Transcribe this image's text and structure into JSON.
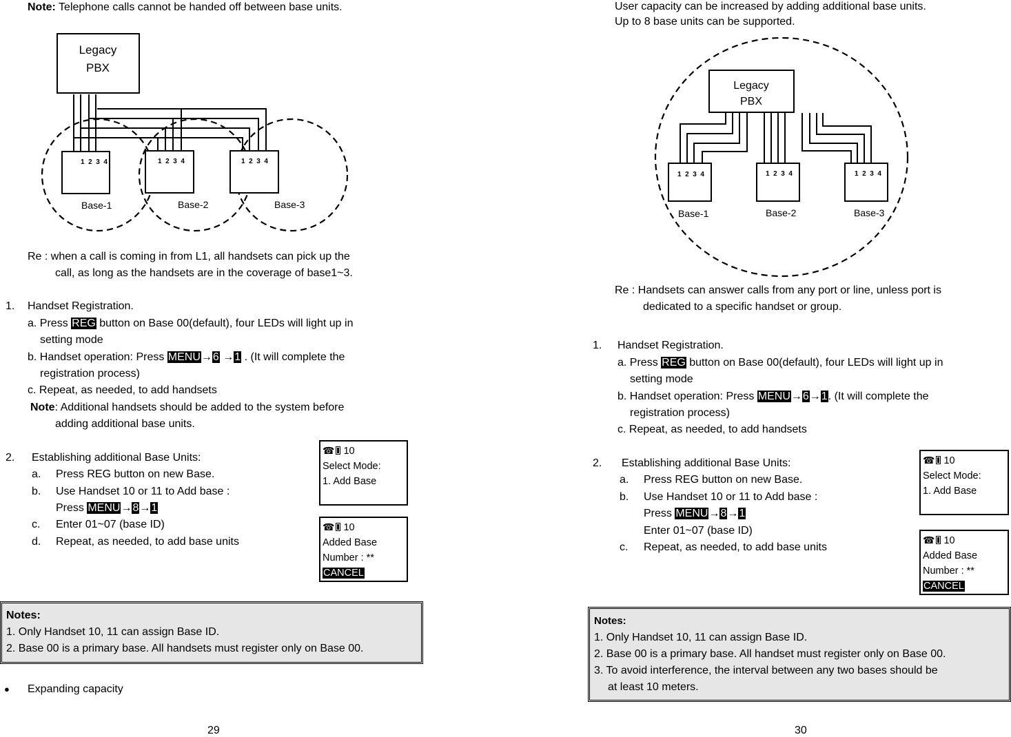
{
  "page_left": {
    "intro_note": {
      "label": "Note:",
      "text": " Telephone calls cannot be handed off between base units."
    },
    "diagram": {
      "pbx_line1": "Legacy",
      "pbx_line2": "PBX",
      "ports": "1  2  3  4",
      "bases": [
        "Base-1",
        "Base-2",
        "Base-3"
      ]
    },
    "re_line1": "Re : when  a call is coming in from L1, all handsets can pick up the",
    "re_line2": "call, as long as the handsets are in the coverage of base1~3.",
    "section1": {
      "num": "1.",
      "title": "Handset Registration.",
      "a_pre": "a. Press ",
      "a_key": "REG",
      "a_post": " button on Base 00(default), four LEDs will light up in",
      "a_cont": "setting mode",
      "b_pre": "b. Handset operation: Press ",
      "b_key1": "MENU",
      "arrow": "→",
      "b_key2": "6",
      "b_key3": "1",
      "b_post": " . (It will complete the",
      "b_cont": "registration process)",
      "c": "c. Repeat, as needed, to add handsets",
      "note_label": "Note",
      "note_text": ": Additional handsets should be added to the system before",
      "note_cont": "adding additional base units."
    },
    "section2": {
      "num": "2.",
      "title": "Establishing additional Base Units:",
      "items": [
        {
          "letter": "a.",
          "text": "Press REG button on new Base."
        },
        {
          "letter": "b.",
          "text": "Use Handset 10 or 11 to Add base :"
        },
        {
          "letter": "c.",
          "text": "Enter 01~07 (base ID)"
        },
        {
          "letter": "d.",
          "text": "Repeat, as needed, to add base units"
        }
      ],
      "press_label": "Press ",
      "key1": "MENU",
      "key2": "8",
      "key3": "1"
    },
    "lcd1": {
      "phone_icon": "☎",
      "handset_num": "10",
      "line2": "Select Mode:",
      "line3": "1. Add Base"
    },
    "lcd2": {
      "phone_icon": "☎",
      "handset_num": "10",
      "line2": "Added Base",
      "line3": "Number : **",
      "line4": "CANCEL"
    },
    "notes": {
      "title": "Notes:",
      "items": [
        "1. Only Handset 10, 11 can assign Base ID.",
        "2. Base 00 is a primary base. All handsets must register only on Base 00."
      ]
    },
    "bullet": {
      "symbol": "●",
      "text": "Expanding capacity"
    },
    "page_number": "29"
  },
  "page_right": {
    "intro_line1": "User capacity can be increased by adding additional base units.",
    "intro_line2": "Up to 8 base units can be supported.",
    "diagram": {
      "pbx_line1": "Legacy",
      "pbx_line2": "PBX",
      "ports": "1  2  3  4",
      "bases": [
        "Base-1",
        "Base-2",
        "Base-3"
      ]
    },
    "re_line1": "Re : Handsets can answer calls from any port or line, unless port is",
    "re_line2": "dedicated to a specific handset or group.",
    "section1": {
      "num": "1.",
      "title": "Handset Registration.",
      "a_pre": "a. Press ",
      "a_key": "REG",
      "a_post": " button on Base 00(default), four LEDs will light up in",
      "a_cont": "setting mode",
      "b_pre": "b. Handset operation: Press ",
      "b_key1": "MENU",
      "arrow": "→",
      "b_key2": "6",
      "b_key3": "1",
      "b_post": ". (It will complete the",
      "b_cont": "registration process)",
      "c": "c. Repeat, as needed, to add handsets"
    },
    "section2": {
      "num": "2.",
      "title": "Establishing additional Base Units:",
      "items": [
        {
          "letter": "a.",
          "text": "Press REG button on new Base."
        },
        {
          "letter": "b.",
          "text": "Use Handset 10 or 11 to Add base :"
        },
        {
          "letter": "c.",
          "text": "Repeat, as needed, to add base units"
        }
      ],
      "press_label": "Press ",
      "key1": "MENU",
      "key2": "8",
      "key3": "1",
      "enter_line": "Enter 01~07 (base ID)"
    },
    "lcd1": {
      "phone_icon": "☎",
      "handset_num": "10",
      "line2": "Select Mode:",
      "line3": "1. Add Base"
    },
    "lcd2": {
      "phone_icon": "☎",
      "handset_num": "10",
      "line2": "Added Base",
      "line3": "Number : **",
      "line4": "CANCEL"
    },
    "notes": {
      "title": "Notes:",
      "items": [
        "1. Only Handset 10, 11 can assign Base ID.",
        "2. Base 00 is a primary base. All handset must register only on Base 00.",
        "3. To avoid interference, the interval between any two bases should be",
        "at least 10 meters."
      ]
    },
    "page_number": "30"
  }
}
